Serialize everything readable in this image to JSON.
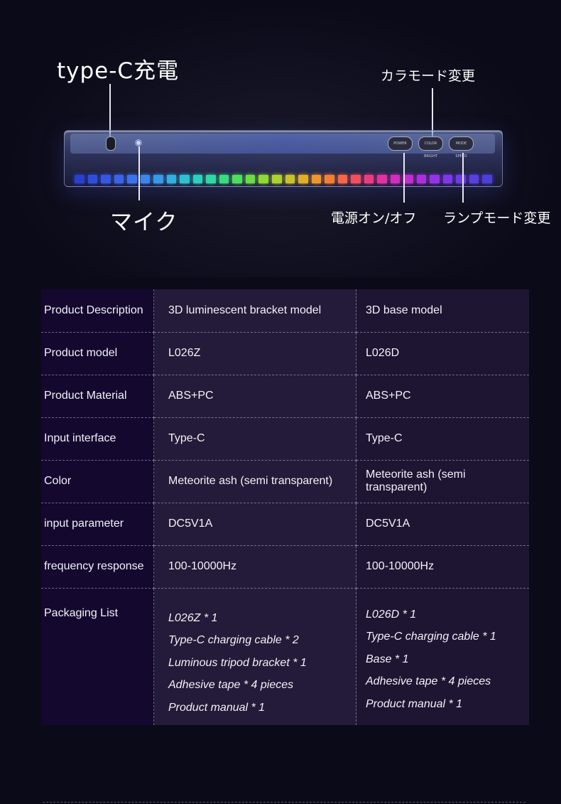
{
  "callouts": {
    "typec": "type-C充電",
    "mic": "マイク",
    "color_mode": "カラモード変更",
    "power": "電源オン/オフ",
    "lamp_mode": "ランプモード変更"
  },
  "device_buttons": {
    "power": "POWER",
    "color_bright": "COLOR BRIGHT",
    "mode_speed": "MODE SPEED"
  },
  "led_colors": [
    "#2a3fd0",
    "#2e4ddd",
    "#3656e4",
    "#3a64e8",
    "#3b74ea",
    "#3a86ec",
    "#3799e8",
    "#33aee0",
    "#2fc1d2",
    "#2ecfbf",
    "#30d8a3",
    "#39dc82",
    "#4ede5f",
    "#6bdd44",
    "#8ed934",
    "#aed12f",
    "#c9c22d",
    "#dfaf2c",
    "#ee972e",
    "#f47e35",
    "#f56648",
    "#f24f62",
    "#eb3c82",
    "#e032a2",
    "#d12ebd",
    "#bf2ed2",
    "#aa30df",
    "#9434e6",
    "#7d38ea",
    "#693de8",
    "#5840e0",
    "#4a41d8"
  ],
  "table": {
    "rows": [
      {
        "label": "Product Description",
        "a": "3D luminescent bracket model",
        "b": "3D base model"
      },
      {
        "label": "Product model",
        "a": "L026Z",
        "b": "L026D"
      },
      {
        "label": "Product Material",
        "a": "ABS+PC",
        "b": "ABS+PC"
      },
      {
        "label": "Input interface",
        "a": "Type-C",
        "b": "Type-C"
      },
      {
        "label": "Color",
        "a": "Meteorite ash (semi transparent)",
        "b": "Meteorite ash (semi transparent)"
      },
      {
        "label": "input parameter",
        "a": "DC5V1A",
        "b": "DC5V1A"
      },
      {
        "label": "frequency response",
        "a": "100-10000Hz",
        "b": "100-10000Hz"
      }
    ],
    "packaging": {
      "label": "Packaging List",
      "a": [
        "L026Z * 1",
        "Type-C charging cable * 2",
        "Luminous tripod bracket * 1",
        "Adhesive tape * 4 pieces",
        "Product manual * 1"
      ],
      "b": [
        "L026D * 1",
        "Type-C charging cable * 1",
        "Base * 1",
        "Adhesive tape * 4 pieces",
        "Product manual * 1"
      ]
    }
  }
}
